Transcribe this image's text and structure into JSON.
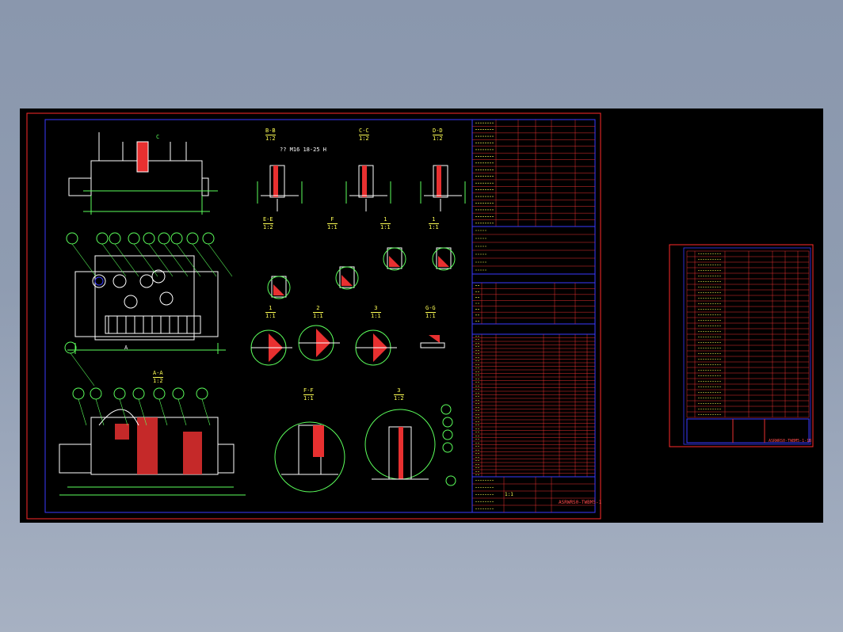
{
  "app": {
    "title": ""
  },
  "main_sheet": {
    "section_labels": [
      {
        "id": "sec-bb",
        "top": "B-B",
        "bottom": "1:2"
      },
      {
        "id": "sec-cc",
        "top": "C-C",
        "bottom": "1:2"
      },
      {
        "id": "sec-dd",
        "top": "D-D",
        "bottom": "1:2"
      },
      {
        "id": "sec-ee",
        "top": "E-E",
        "bottom": "1:2"
      },
      {
        "id": "sec-f",
        "top": "F",
        "bottom": "1:1"
      },
      {
        "id": "sec-g",
        "top": "1",
        "bottom": "1:1"
      },
      {
        "id": "sec-h",
        "top": "1",
        "bottom": "1:1"
      },
      {
        "id": "sec-i",
        "top": "1",
        "bottom": "1:1"
      },
      {
        "id": "sec-j",
        "top": "2",
        "bottom": "1:1"
      },
      {
        "id": "sec-k",
        "top": "3",
        "bottom": "1:1"
      },
      {
        "id": "sec-gg",
        "top": "G-G",
        "bottom": "1:1"
      },
      {
        "id": "sec-aa",
        "top": "A-A",
        "bottom": "1:2"
      },
      {
        "id": "sec-ff",
        "top": "F-F",
        "bottom": "1:1"
      },
      {
        "id": "sec-3",
        "top": "3",
        "bottom": "1:2"
      }
    ],
    "thread_callout": "?? M16 18-25 H",
    "view_c_label": "C",
    "view_a_label": "A",
    "title_block": {
      "drawing_no": "ASRWRS0-TWBM5-1",
      "scale": "1:1",
      "sheet": "1:2"
    }
  },
  "side_sheet": {
    "drawing_no": "ASRWRS0-TWBM5-1-1B",
    "rows": 30
  },
  "colors": {
    "background": "#8f9cb1",
    "canvas": "#000000",
    "frame_red": "#ff2a2a",
    "frame_blue": "#3a3aff",
    "geometry_white": "#ffffff",
    "dimension_green": "#5bff5b",
    "hatch_red": "#e83030",
    "text_yellow": "#ffff55"
  }
}
